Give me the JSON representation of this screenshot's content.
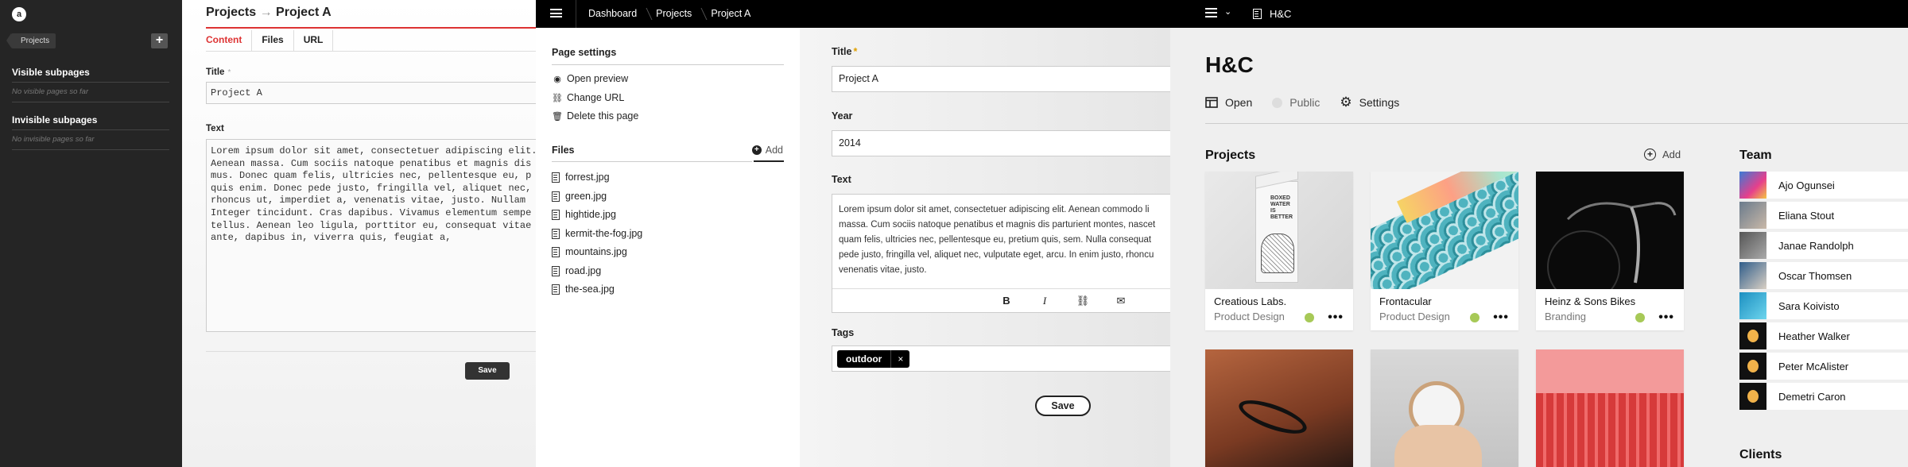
{
  "p1": {
    "logo": "a",
    "breadcrumb": "Projects",
    "add_icon": "plus-icon",
    "visible_heading": "Visible subpages",
    "visible_empty": "No visible pages so far",
    "invisible_heading": "Invisible subpages",
    "invisible_empty": "No invisible pages so far"
  },
  "p2": {
    "title_parent": "Projects",
    "title_arrow": "→",
    "title_page": "Project A",
    "tabs": [
      "Content",
      "Files",
      "URL"
    ],
    "title_label": "Title",
    "title_required": "*",
    "title_value": "Project A",
    "text_label": "Text",
    "text_value": "Lorem ipsum dolor sit amet, consectetuer adipiscing elit.\nAenean massa. Cum sociis natoque penatibus et magnis dis\nmus. Donec quam felis, ultricies nec, pellentesque eu, p\nquis enim. Donec pede justo, fringilla vel, aliquet nec,\nrhoncus ut, imperdiet a, venenatis vitae, justo. Nullam\nInteger tincidunt. Cras dapibus. Vivamus elementum sempe\ntellus. Aenean leo ligula, porttitor eu, consequat vitae\nante, dapibus in, viverra quis, feugiat a,",
    "save": "Save"
  },
  "p3": {
    "breadcrumbs": [
      "Dashboard",
      "Projects",
      "Project A"
    ],
    "page_settings": "Page settings",
    "actions": [
      {
        "icon": "preview-icon",
        "label": "Open preview"
      },
      {
        "icon": "link-icon",
        "label": "Change URL"
      },
      {
        "icon": "trash-icon",
        "label": "Delete this page"
      }
    ],
    "files_heading": "Files",
    "files_add": "Add",
    "files": [
      "forrest.jpg",
      "green.jpg",
      "hightide.jpg",
      "kermit-the-fog.jpg",
      "mountains.jpg",
      "road.jpg",
      "the-sea.jpg"
    ],
    "title_label": "Title",
    "title_required": "*",
    "title_value": "Project A",
    "year_label": "Year",
    "year_value": "2014",
    "text_label": "Text",
    "text_value": "Lorem ipsum dolor sit amet, consectetuer adipiscing elit. Aenean commodo li\nmassa. Cum sociis natoque penatibus et magnis dis parturient montes, nascet\nquam felis, ultricies nec, pellentesque eu, pretium quis, sem. Nulla consequat\npede justo, fringilla vel, aliquet nec, vulputate eget, arcu. In enim justo, rhoncu\nvenenatis vitae, justo.",
    "toolbar": [
      "B",
      "I",
      "link",
      "email"
    ],
    "tags_label": "Tags",
    "tag": "outdoor",
    "tag_remove": "×",
    "save": "Save"
  },
  "p4": {
    "site_name": "H&C",
    "page_title": "H&C",
    "options": [
      {
        "icon": "open-icon",
        "label": "Open"
      },
      {
        "icon": "status-dot-icon",
        "label": "Public"
      },
      {
        "icon": "gear-icon",
        "label": "Settings"
      }
    ],
    "projects_heading": "Projects",
    "projects_add": "Add",
    "cards": [
      {
        "name": "Creatious Labs.",
        "category": "Product Design",
        "status_color": "#a7c957"
      },
      {
        "name": "Frontacular",
        "category": "Product Design",
        "status_color": "#a7c957"
      },
      {
        "name": "Heinz & Sons Bikes",
        "category": "Branding",
        "status_color": "#a7c957"
      }
    ],
    "team_heading": "Team",
    "team": [
      "Ajo Ogunsei",
      "Eliana Stout",
      "Janae Randolph",
      "Oscar Thomsen",
      "Sara Koivisto",
      "Heather Walker",
      "Peter McAlister",
      "Demetri Caron"
    ],
    "clients_heading": "Clients"
  }
}
